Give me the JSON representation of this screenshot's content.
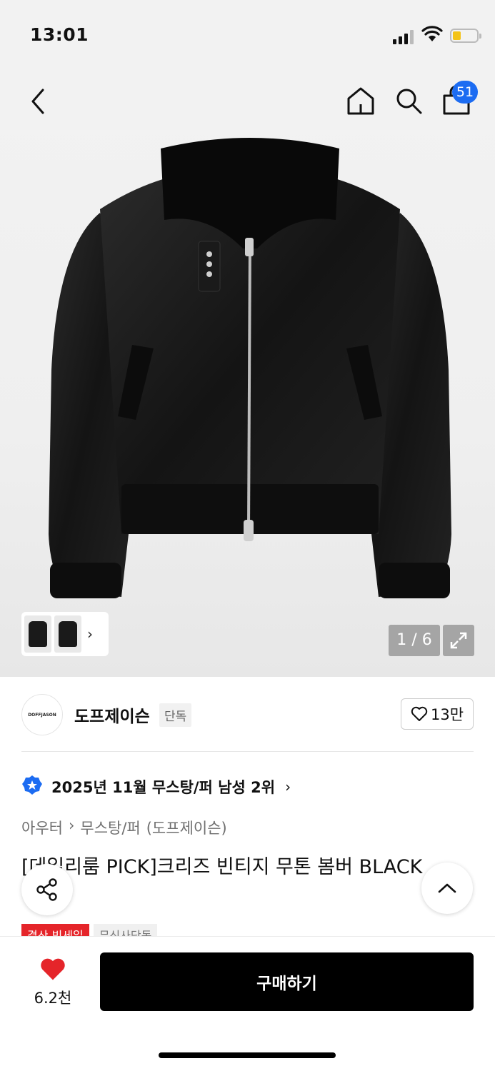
{
  "status": {
    "time": "13:01"
  },
  "header": {
    "icons": [
      "back-icon",
      "home-icon",
      "search-icon",
      "shopping-bag-icon"
    ],
    "cart_badge": "51"
  },
  "gallery": {
    "counter": "1 / 6"
  },
  "brand": {
    "logo_text": "DOFFJASON",
    "name": "도프제이슨",
    "tag": "단독",
    "like_count": "13만"
  },
  "ranking": {
    "text": "2025년 11월 무스탕/퍼 남성 2위"
  },
  "breadcrumb": {
    "level1": "아우터",
    "level2": "무스탕/퍼",
    "brand": "(도프제이슨)"
  },
  "product": {
    "title": "[데일리룸 PICK]크리즈 빈티지 무톤 봄버 BLACK",
    "tags": [
      "결산 빅세일",
      "무신사단독"
    ]
  },
  "bottom": {
    "like_count": "6.2천",
    "buy_label": "구매하기"
  },
  "colors": {
    "accent_blue": "#1c6cf2",
    "sale_red": "#e5252a",
    "heart_red": "#e5252a",
    "buy_black": "#000000"
  }
}
